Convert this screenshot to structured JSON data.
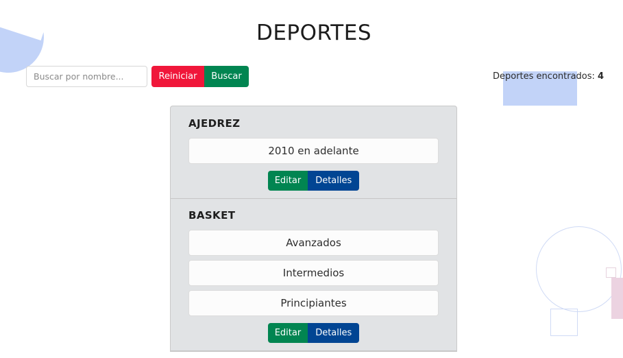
{
  "header": {
    "title": "DEPORTES"
  },
  "search": {
    "placeholder": "Buscar por nombre...",
    "value": ""
  },
  "toolbar": {
    "reset_label": "Reiniciar",
    "search_label": "Buscar"
  },
  "summary": {
    "label": "Deportes encontrados:",
    "count": "4"
  },
  "sports": [
    {
      "name": "AJEDREZ",
      "categories": [
        "2010 en adelante"
      ],
      "edit_label": "Editar",
      "details_label": "Detalles"
    },
    {
      "name": "BASKET",
      "categories": [
        "Avanzados",
        "Intermedios",
        "Principiantes"
      ],
      "edit_label": "Editar",
      "details_label": "Detalles"
    }
  ],
  "colors": {
    "reset": "#f0173a",
    "search": "#018551",
    "edit": "#018551",
    "details": "#014593",
    "card_bg": "#e1e3e5",
    "decor_blue": "#c2d3f8",
    "decor_pink": "#ecd3e1"
  }
}
